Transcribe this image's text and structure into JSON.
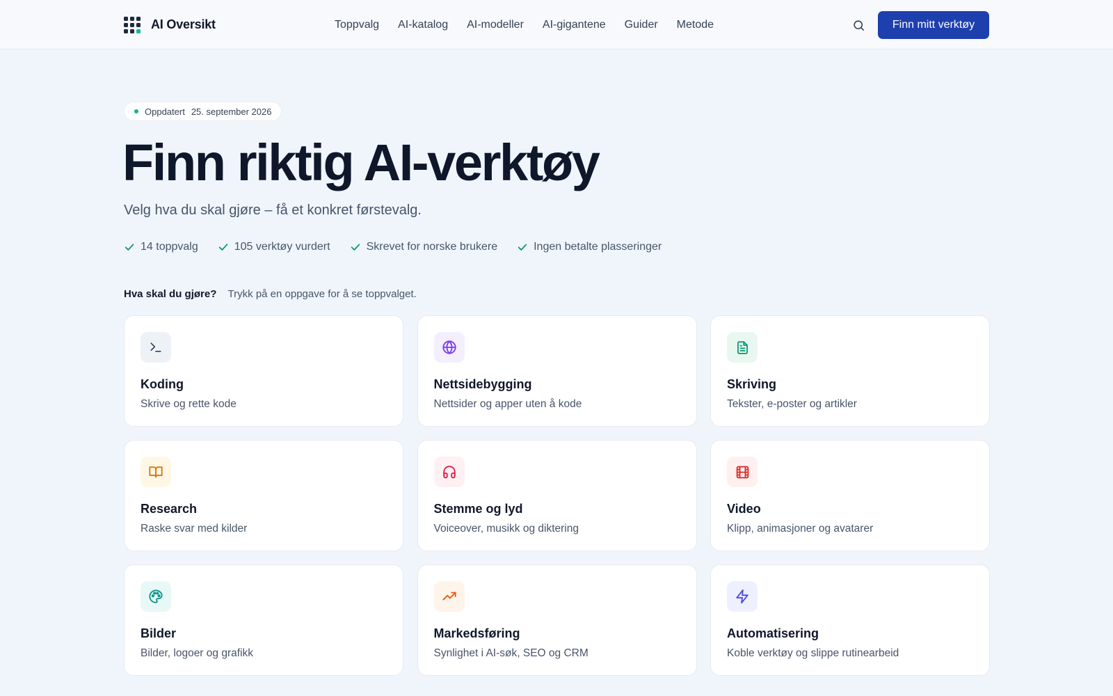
{
  "header": {
    "brand": "AI Oversikt",
    "nav": [
      "Toppvalg",
      "AI-katalog",
      "AI-modeller",
      "AI-gigantene",
      "Guider",
      "Metode"
    ],
    "cta": "Finn mitt verktøy"
  },
  "hero": {
    "badge_label": "Oppdatert",
    "badge_date": "25. september 2026",
    "title": "Finn riktig AI-verktøy",
    "subtitle": "Velg hva du skal gjøre – få et konkret førstevalg.",
    "features": [
      "14 toppvalg",
      "105 verktøy vurdert",
      "Skrevet for norske brukere",
      "Ingen betalte plasseringer"
    ]
  },
  "question": {
    "label": "Hva skal du gjøre?",
    "hint": "Trykk på en oppgave for å se toppvalget."
  },
  "cards": [
    {
      "title": "Koding",
      "desc": "Skrive og rette kode",
      "icon": "terminal-icon",
      "color": "#334155",
      "bg": "#eef1f6"
    },
    {
      "title": "Nettsidebygging",
      "desc": "Nettsider og apper uten å kode",
      "icon": "globe-icon",
      "color": "#7c3aed",
      "bg": "#f3efff"
    },
    {
      "title": "Skriving",
      "desc": "Tekster, e-poster og artikler",
      "icon": "document-icon",
      "color": "#059669",
      "bg": "#e8f8f1"
    },
    {
      "title": "Research",
      "desc": "Raske svar med kilder",
      "icon": "book-icon",
      "color": "#d97706",
      "bg": "#fff7e6"
    },
    {
      "title": "Stemme og lyd",
      "desc": "Voiceover, musikk og diktering",
      "icon": "headphones-icon",
      "color": "#e11d48",
      "bg": "#fff0f3"
    },
    {
      "title": "Video",
      "desc": "Klipp, animasjoner og avatarer",
      "icon": "film-icon",
      "color": "#dc2626",
      "bg": "#fff0f0"
    },
    {
      "title": "Bilder",
      "desc": "Bilder, logoer og grafikk",
      "icon": "palette-icon",
      "color": "#0d9488",
      "bg": "#e8f8f6"
    },
    {
      "title": "Markedsføring",
      "desc": "Synlighet i AI-søk, SEO og CRM",
      "icon": "trending-up-icon",
      "color": "#ea580c",
      "bg": "#fff4ea"
    },
    {
      "title": "Automatisering",
      "desc": "Koble verktøy og slippe rutinearbeid",
      "icon": "lightning-icon",
      "color": "#4f46e5",
      "bg": "#eef0ff"
    }
  ]
}
